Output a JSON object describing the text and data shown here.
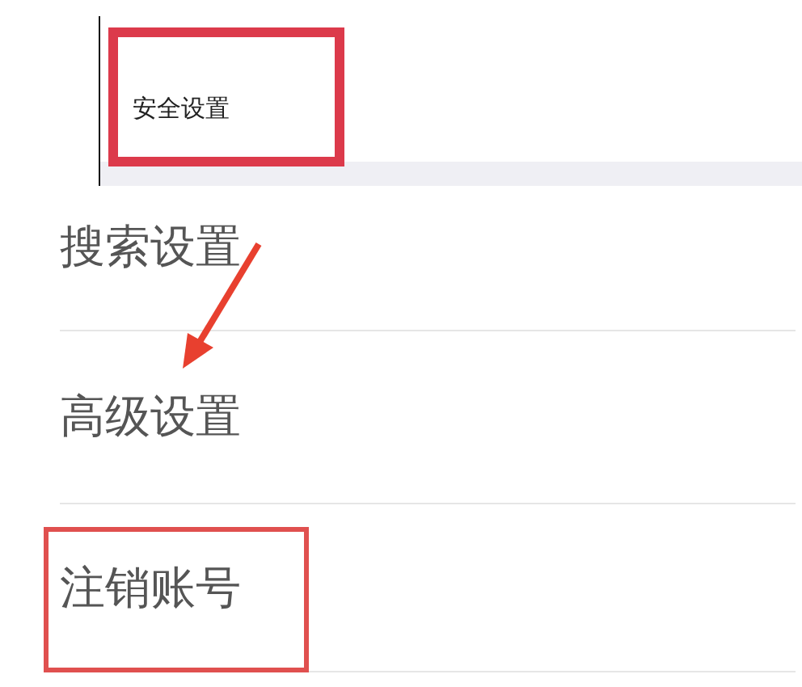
{
  "header_item": {
    "label": "安全设置",
    "highlighted": true
  },
  "items": [
    {
      "label": "搜索设置",
      "highlighted": false
    },
    {
      "label": "高级设置",
      "highlighted": false
    },
    {
      "label": "注销账号",
      "highlighted": true
    }
  ]
}
